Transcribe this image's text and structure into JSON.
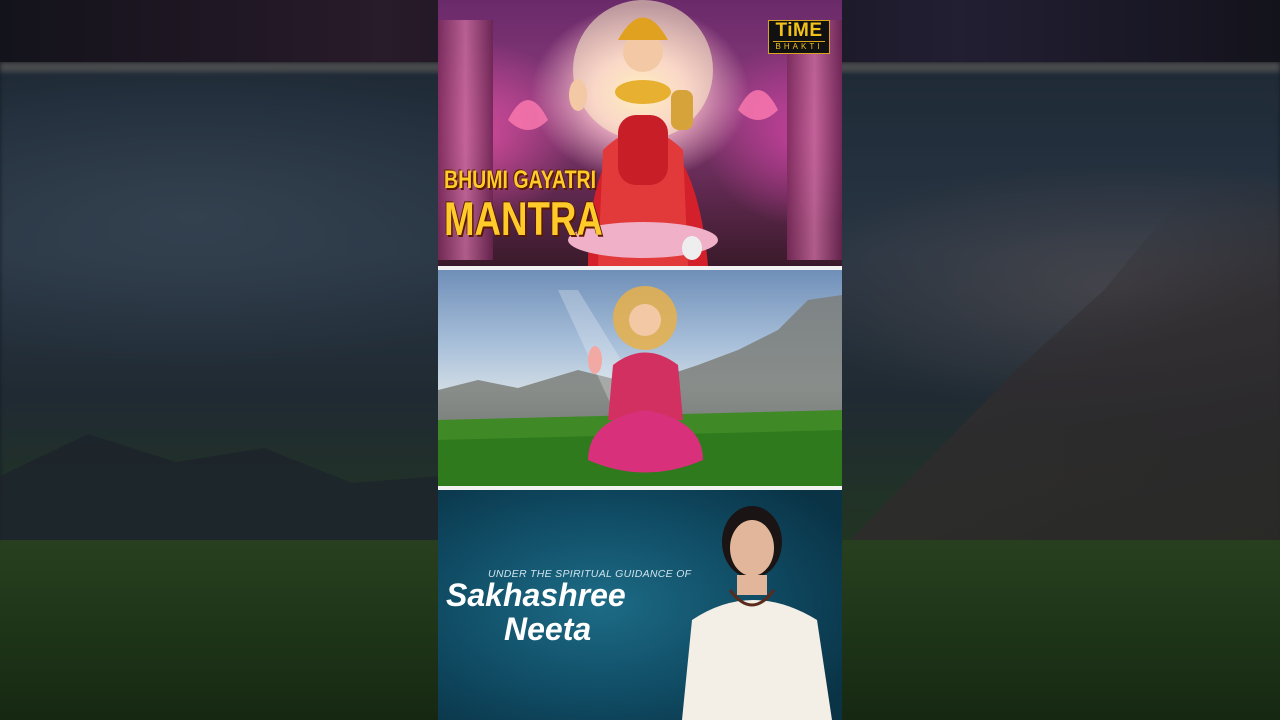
{
  "panel_top": {
    "title_line1": "BHUMI GAYATRI",
    "title_line2": "MANTRA",
    "logo_main": "TiME",
    "logo_sub": "BHAKTI"
  },
  "panel_bottom": {
    "guidance_text": "UNDER THE SPIRITUAL GUIDANCE OF",
    "name_line1": "Sakhashree",
    "name_line2": "Neeta"
  },
  "colors": {
    "title_gold": "#ffcb2a",
    "logo_gold": "#f2c21a",
    "panel_teal": "#0f4a62"
  }
}
